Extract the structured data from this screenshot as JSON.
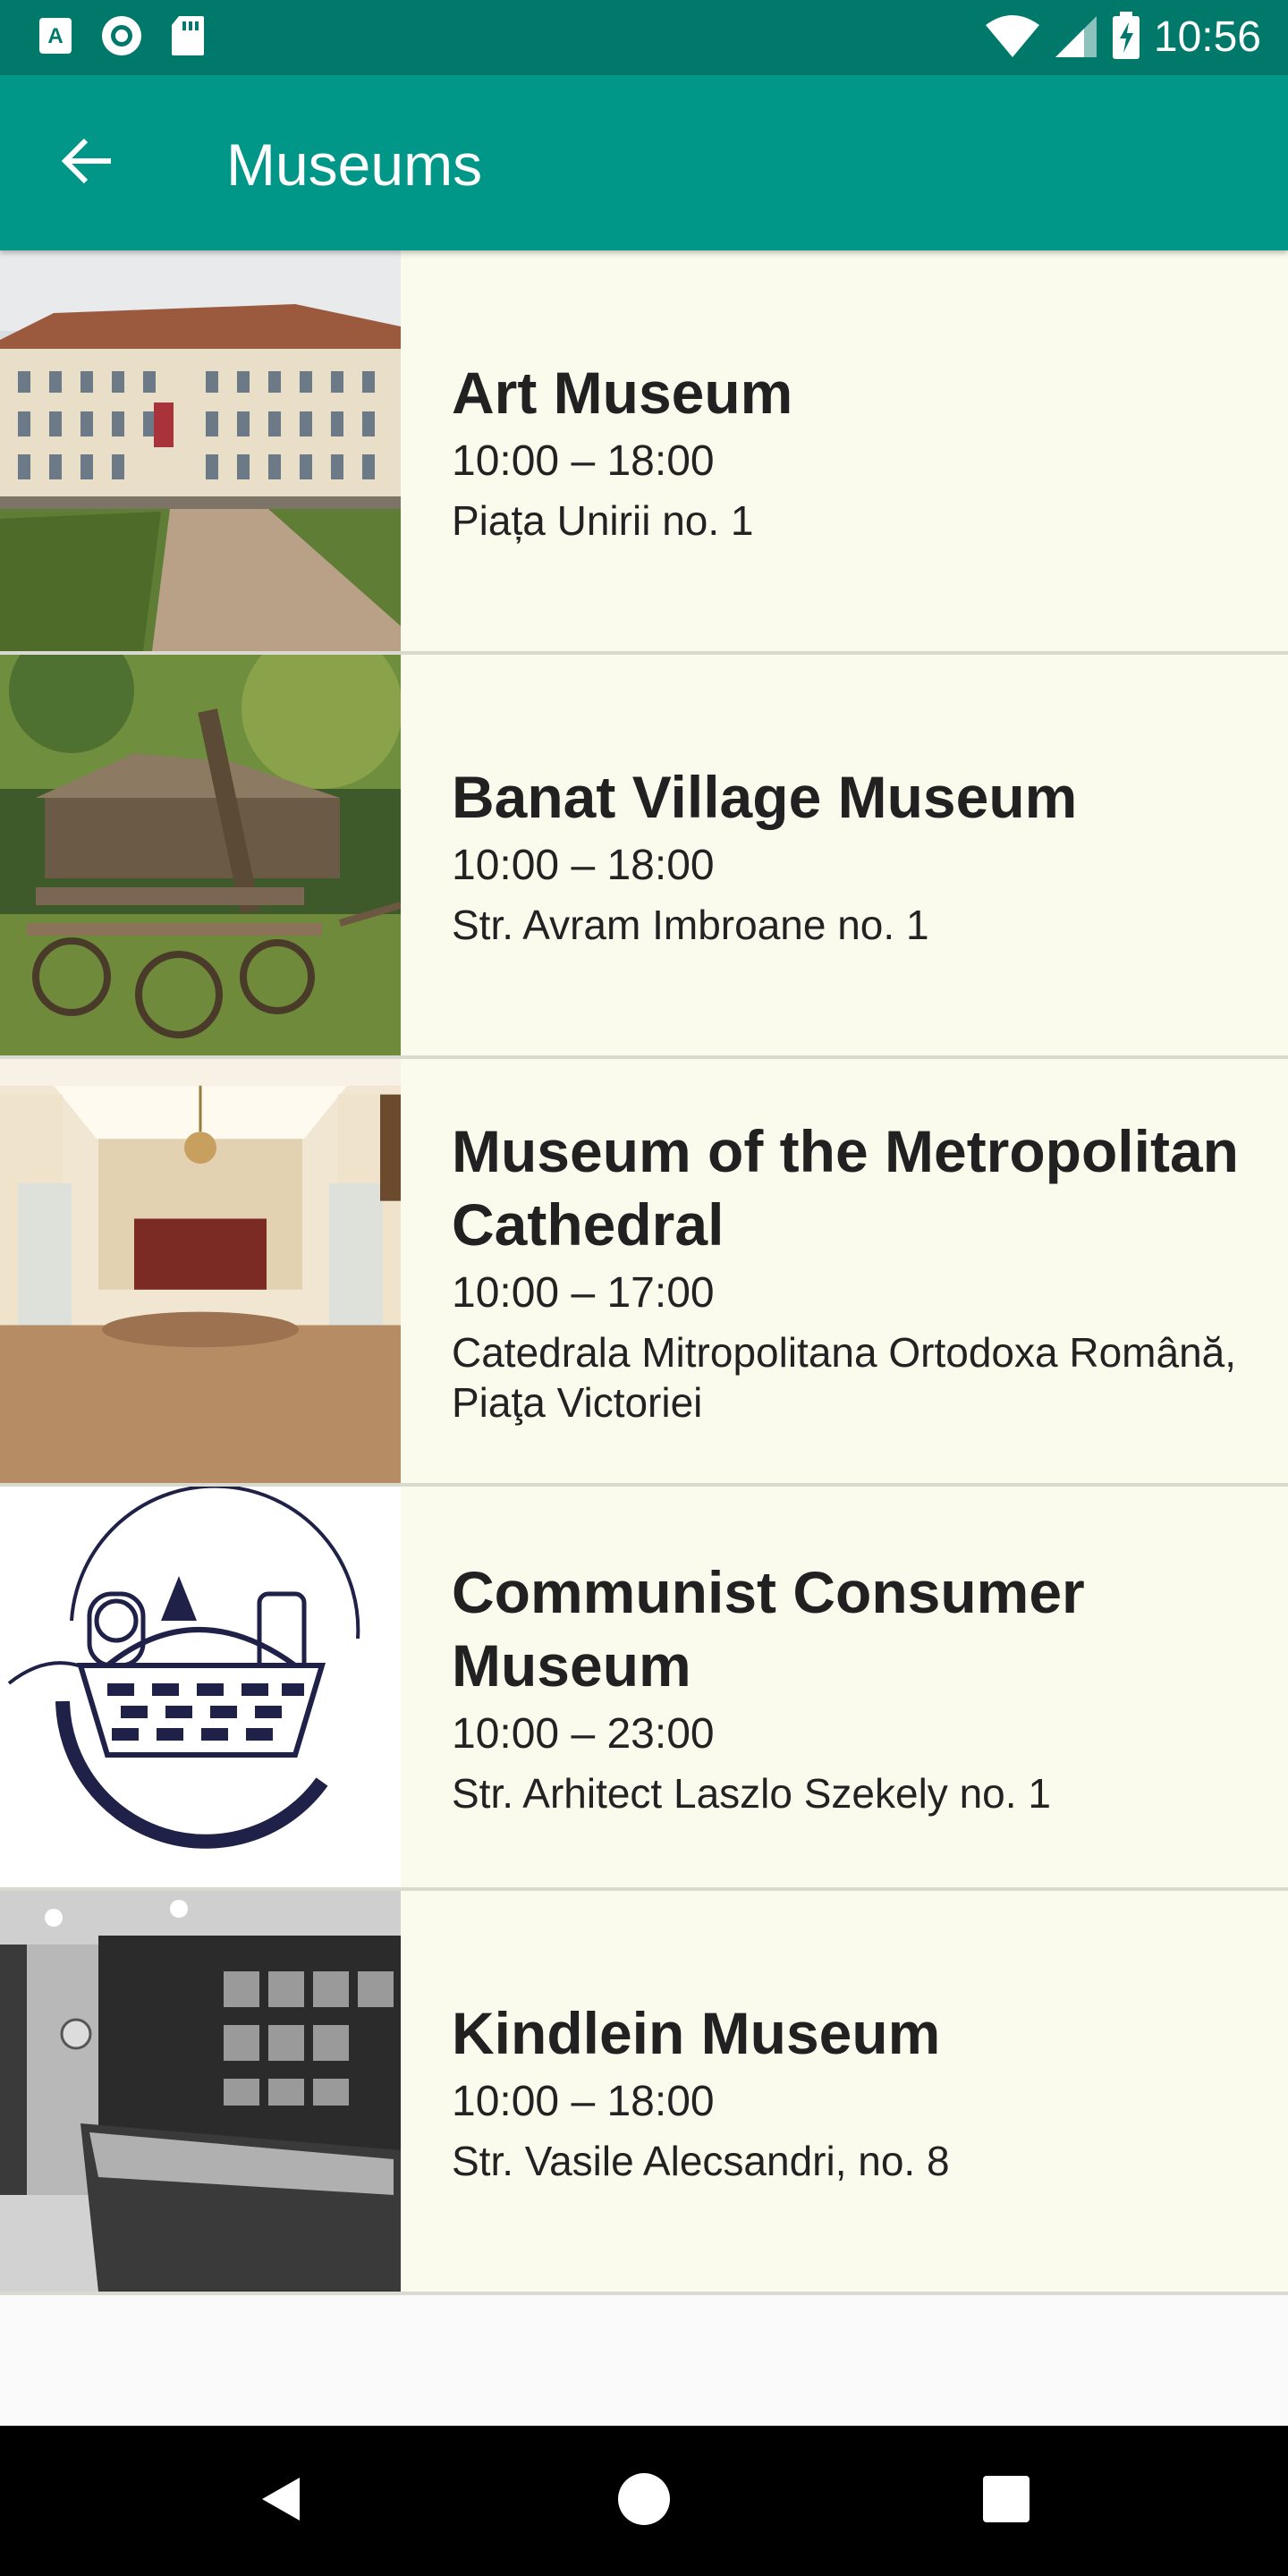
{
  "status_bar": {
    "time": "10:56",
    "left_icons": [
      "a-notification-icon",
      "circle-notification-icon",
      "sd-card-icon"
    ],
    "right_icons": [
      "wifi-icon",
      "signal-icon",
      "battery-charging-icon"
    ]
  },
  "app_bar": {
    "title": "Museums",
    "back_icon": "arrow-back-icon",
    "background": "#009688",
    "status_background": "#00796b"
  },
  "museums": [
    {
      "name": "Art Museum",
      "hours": "10:00 – 18:00",
      "address": "Piața Unirii no. 1",
      "image": "baroque-palace-photo"
    },
    {
      "name": "Banat Village Museum",
      "hours": "10:00 – 18:00",
      "address": "Str. Avram Imbroane no. 1",
      "image": "village-cart-photo"
    },
    {
      "name": "Museum of the Metropolitan Cathedral",
      "hours": "10:00 – 17:00",
      "address": "Catedrala Mitropolitana Ortodoxa Română, Piaţa Victoriei",
      "image": "exhibition-hall-photo"
    },
    {
      "name": "Communist Consumer Museum",
      "hours": "10:00 – 23:00",
      "address": "Str. Arhitect Laszlo Szekely no. 1",
      "image": "basket-logo-image"
    },
    {
      "name": "Kindlein Museum",
      "hours": "10:00 – 18:00",
      "address": "Str. Vasile Alecsandri, no. 8",
      "image": "grayscale-display-cases-photo"
    }
  ],
  "colors": {
    "row_background": "#fbfbed",
    "divider": "#d9d9d0",
    "text": "#212121"
  },
  "nav_bar": {
    "icons": [
      "back-triangle-icon",
      "home-circle-icon",
      "recents-square-icon"
    ]
  }
}
